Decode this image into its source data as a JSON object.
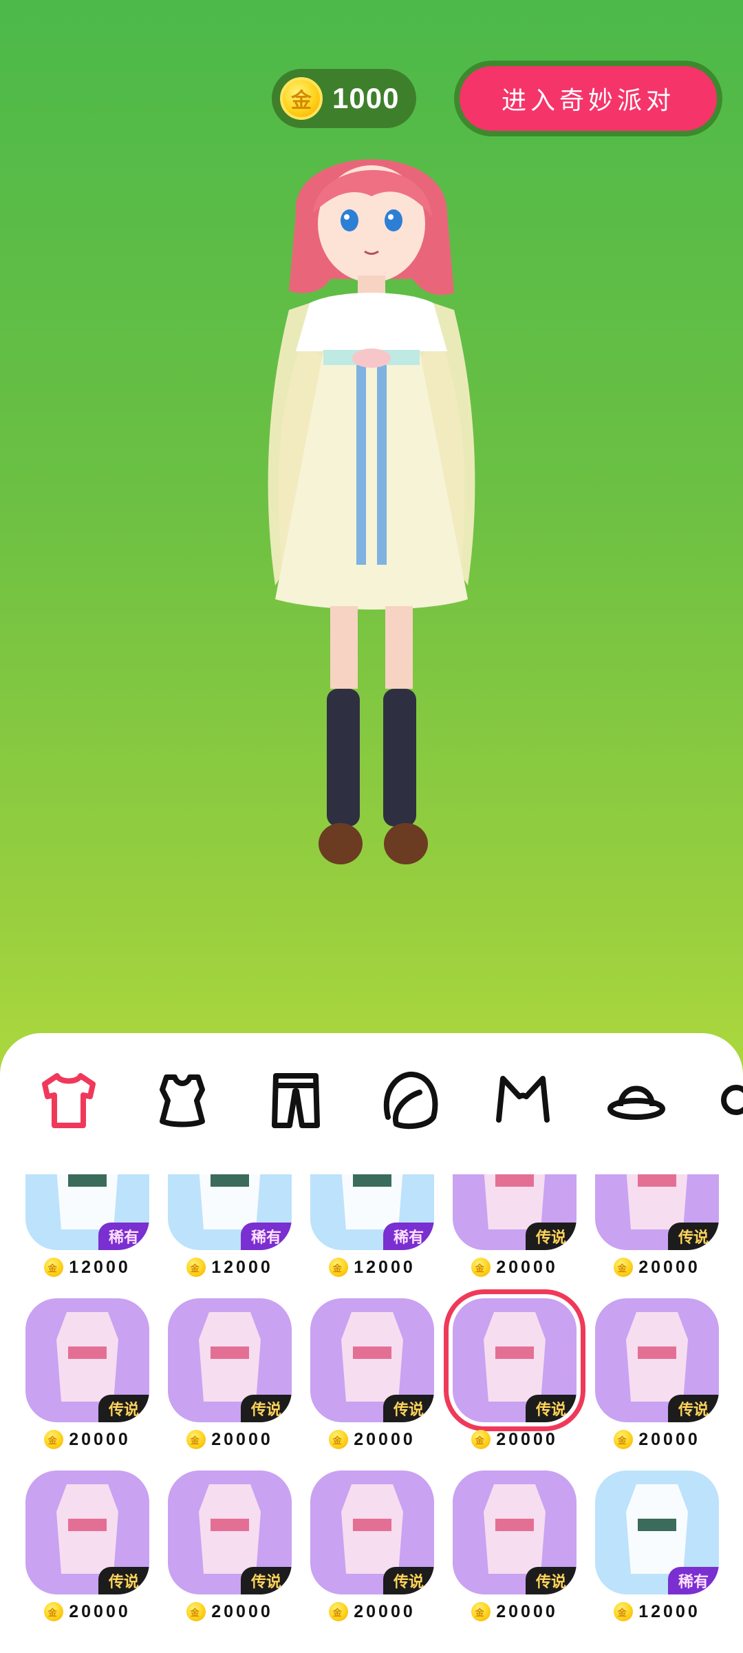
{
  "header": {
    "coin_icon": "coin-icon",
    "coin_glyph": "金",
    "coin_amount": "1000",
    "party_button_label": "进入奇妙派对"
  },
  "colors": {
    "accent": "#f5346a",
    "legend_badge": "#1c1c1c",
    "rare_badge": "#7a2fd0",
    "selected_outline": "#f0395a"
  },
  "categories": [
    {
      "name": "top",
      "icon": "shirt-icon",
      "active": true
    },
    {
      "name": "vest",
      "icon": "vest-icon",
      "active": false
    },
    {
      "name": "pants",
      "icon": "pants-icon",
      "active": false
    },
    {
      "name": "hair",
      "icon": "hair-icon",
      "active": false
    },
    {
      "name": "ears",
      "icon": "cat-ears-icon",
      "active": false
    },
    {
      "name": "hat",
      "icon": "hat-icon",
      "active": false
    },
    {
      "name": "more",
      "icon": "circle-icon",
      "active": false
    }
  ],
  "items": [
    {
      "price": "12000",
      "badge": "稀有",
      "tier": "rare",
      "bg": "blue"
    },
    {
      "price": "12000",
      "badge": "稀有",
      "tier": "rare",
      "bg": "blue"
    },
    {
      "price": "12000",
      "badge": "稀有",
      "tier": "rare",
      "bg": "blue"
    },
    {
      "price": "20000",
      "badge": "传说",
      "tier": "legend",
      "bg": "purple"
    },
    {
      "price": "20000",
      "badge": "传说",
      "tier": "legend",
      "bg": "purple"
    },
    {
      "price": "20000",
      "badge": "传说",
      "tier": "legend",
      "bg": "purple"
    },
    {
      "price": "20000",
      "badge": "传说",
      "tier": "legend",
      "bg": "purple"
    },
    {
      "price": "20000",
      "badge": "传说",
      "tier": "legend",
      "bg": "purple"
    },
    {
      "price": "20000",
      "badge": "传说",
      "tier": "legend",
      "bg": "purple",
      "selected": true
    },
    {
      "price": "20000",
      "badge": "传说",
      "tier": "legend",
      "bg": "purple"
    },
    {
      "price": "20000",
      "badge": "传说",
      "tier": "legend",
      "bg": "purple"
    },
    {
      "price": "20000",
      "badge": "传说",
      "tier": "legend",
      "bg": "purple"
    },
    {
      "price": "20000",
      "badge": "传说",
      "tier": "legend",
      "bg": "purple"
    },
    {
      "price": "20000",
      "badge": "传说",
      "tier": "legend",
      "bg": "purple"
    },
    {
      "price": "12000",
      "badge": "稀有",
      "tier": "rare",
      "bg": "blue"
    }
  ]
}
